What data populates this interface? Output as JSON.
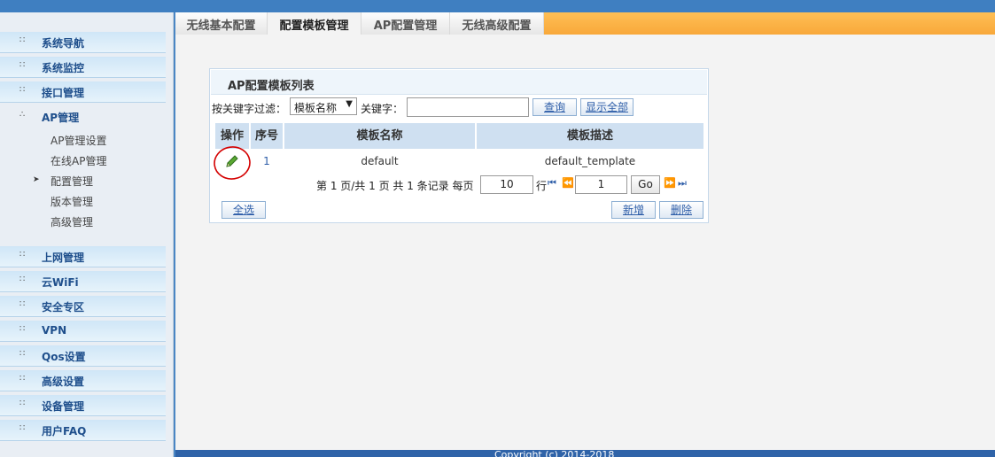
{
  "sidebar": {
    "items": [
      {
        "label": "系统导航"
      },
      {
        "label": "系统监控"
      },
      {
        "label": "接口管理"
      },
      {
        "label": "AP管理"
      },
      {
        "label": "上网管理"
      },
      {
        "label": "云WiFi"
      },
      {
        "label": "安全专区"
      },
      {
        "label": "VPN"
      },
      {
        "label": "Qos设置"
      },
      {
        "label": "高级设置"
      },
      {
        "label": "设备管理"
      },
      {
        "label": "用户FAQ"
      }
    ],
    "ap_sub": [
      {
        "label": "AP管理设置"
      },
      {
        "label": "在线AP管理"
      },
      {
        "label": "配置管理"
      },
      {
        "label": "版本管理"
      },
      {
        "label": "高级管理"
      }
    ]
  },
  "tabs": [
    {
      "label": "无线基本配置"
    },
    {
      "label": "配置模板管理"
    },
    {
      "label": "AP配置管理"
    },
    {
      "label": "无线高级配置"
    }
  ],
  "panel": {
    "title": "AP配置模板列表",
    "filter_label": "按关键字过滤：",
    "filter_select": "模板名称",
    "keyword_label": "关键字：",
    "query_button": "查询",
    "show_all_button": "显示全部"
  },
  "table": {
    "headers": [
      "操作",
      "序号",
      "模板名称",
      "模板描述"
    ],
    "rows": [
      {
        "index": "1",
        "name": "default",
        "description": "default_template"
      }
    ]
  },
  "pager": {
    "summary": "第 1 页/共 1 页 共 1 条记录 每页",
    "per_page": "10",
    "row_unit": "行",
    "page_input": "1",
    "go": "Go"
  },
  "actions": {
    "select_all": "全选",
    "add": "新增",
    "delete": "删除"
  },
  "colors": {
    "accent": "#3f7fc1",
    "tab_bar": "#f8a83a",
    "annotation": "#d40000"
  }
}
